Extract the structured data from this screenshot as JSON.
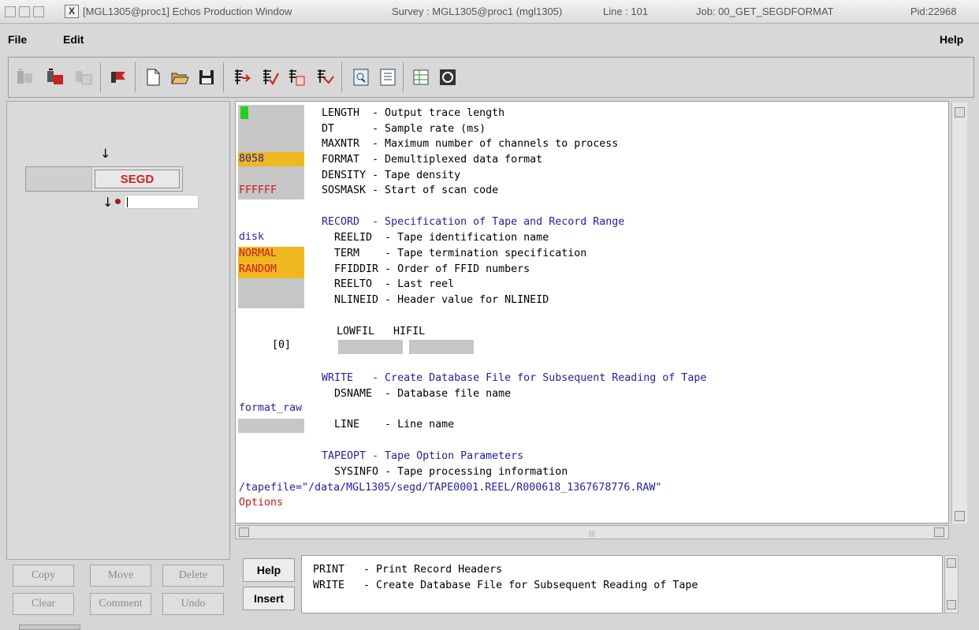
{
  "window": {
    "title": "[MGL1305@proc1] Echos Production Window",
    "survey": "Survey : MGL1305@proc1 (mgl1305)",
    "line": "Line : 101",
    "job": "Job: 00_GET_SEGDFORMAT",
    "pid": "Pid:22968"
  },
  "menu": {
    "file": "File",
    "edit": "Edit",
    "help": "Help"
  },
  "toolbar_icons": [
    "module-gray-icon",
    "module-red-icon",
    "module-disabled-icon",
    "flag-icon",
    "new-file-icon",
    "open-folder-icon",
    "save-icon",
    "insert-line-icon",
    "check-line-icon",
    "copy-line-icon",
    "run-icon",
    "doc-view-icon",
    "doc-list-icon",
    "grid-list-icon",
    "refresh-icon"
  ],
  "flow": {
    "module": "SEGD"
  },
  "left_buttons": {
    "copy": "Copy",
    "move": "Move",
    "delete": "Delete",
    "clear": "Clear",
    "comment": "Comment",
    "undo": "Undo"
  },
  "editor": {
    "gutter": {
      "format": "8058",
      "sosmask": "FFFFFF",
      "reelid": "disk",
      "term": "NORMAL",
      "ffiddir": "RANDOM",
      "lowfil_idx": "[0]",
      "dsname": "format_raw"
    },
    "lines": {
      "length": "LENGTH  - Output trace length",
      "dt": "DT      - Sample rate (ms)",
      "maxntr": "MAXNTR  - Maximum number of channels to process",
      "format": "FORMAT  - Demultiplexed data format",
      "density": "DENSITY - Tape density",
      "sosmask": "SOSMASK - Start of scan code",
      "record": "RECORD  - Specification of Tape and Record Range",
      "reelid": "  REELID  - Tape identification name",
      "term": "  TERM    - Tape termination specification",
      "ffiddir": "  FFIDDIR - Order of FFID numbers",
      "reelto": "  REELTO  - Last reel",
      "nlineid": "  NLINEID - Header value for NLINEID",
      "filters": "LOWFIL   HIFIL",
      "write": "WRITE   - Create Database File for Subsequent Reading of Tape",
      "dsname": "  DSNAME  - Database file name",
      "line": "  LINE    - Line name",
      "tapeopt": "TAPEOPT - Tape Option Parameters",
      "sysinfo": "  SYSINFO - Tape processing information",
      "tapefile": "/tapefile=\"/data/MGL1305/segd/TAPE0001.REEL/R000618_1367678776.RAW\"",
      "options": "Options"
    }
  },
  "help_panel": {
    "help_button": "Help",
    "insert_button": "Insert",
    "lines": [
      "PRINT   - Print Record Headers",
      "WRITE   - Create Database File for Subsequent Reading of Tape"
    ]
  },
  "colors": {
    "accent_blue": "#1f1fb0",
    "error_red": "#cc1a1a",
    "value_orange": "#f0b820",
    "ok_green": "#22d022"
  }
}
